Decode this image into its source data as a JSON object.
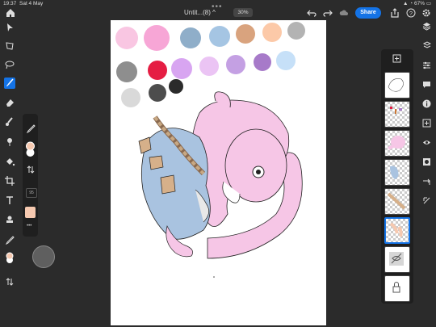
{
  "status": {
    "time": "19:37",
    "date": "Sat 4 May",
    "battery": "67%"
  },
  "document": {
    "title": "Untit...(8) ^",
    "zoom": "30%"
  },
  "toolbar": {
    "share_label": "Share"
  },
  "brush_panel": {
    "flow_value": "95"
  },
  "colors": {
    "accent": "#1473e6",
    "primary": "#f6c9b0",
    "secondary": "#ffffff"
  },
  "swatches": [
    "#f9c6e2",
    "#f7a6d6",
    "#8faec9",
    "#a5c5e3",
    "#d9a37e",
    "#fcc9a8",
    "#b3b3b3",
    "#8e8e8e",
    "#e51d43",
    "#d8a5f1",
    "#ebc4f4",
    "#c4a0e3",
    "#a77ac9",
    "#c6e0f8",
    "#d9d9d9",
    "#4d4d4d",
    "#2b2b2b"
  ],
  "left_tools": [
    "home-icon",
    "select-icon",
    "transform-icon",
    "lasso-icon",
    "brush-icon",
    "eraser-icon",
    "smudge-icon",
    "blur-icon",
    "fill-icon",
    "crop-icon",
    "text-icon",
    "stamp-icon",
    "eyedropper-icon",
    "color-chip-icon",
    "swap-icon"
  ],
  "right_tools": [
    "layers-icon",
    "layer-properties-icon",
    "adjust-icon",
    "comments-icon",
    "info-icon",
    "add-layer-icon",
    "eye-icon",
    "mask-icon",
    "move-icon",
    "clip-icon"
  ],
  "layers": [
    {
      "name": "layer-sketch",
      "active": false
    },
    {
      "name": "layer-marks",
      "active": false
    },
    {
      "name": "layer-pink",
      "active": false
    },
    {
      "name": "layer-blue",
      "active": false
    },
    {
      "name": "layer-brown",
      "active": false
    },
    {
      "name": "layer-peach",
      "active": true
    },
    {
      "name": "layer-hidden",
      "active": false
    },
    {
      "name": "layer-locked",
      "active": false
    }
  ]
}
